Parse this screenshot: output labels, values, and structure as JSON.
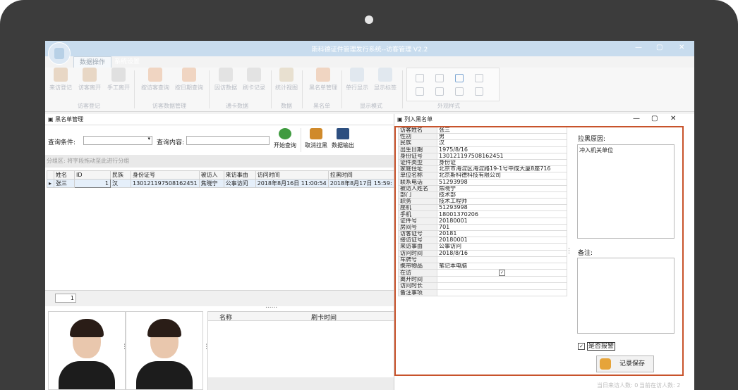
{
  "app": {
    "title": "斯科德证件管理发行系统--访客管理 V2.2",
    "tabs": [
      "数据操作",
      "系统设置"
    ]
  },
  "ribbon": {
    "buttons": [
      "来访登记",
      "访客离开",
      "手工离开",
      "按访客查询",
      "按日期查询",
      "因访数据",
      "刷卡记录",
      "统计视图",
      "黑名单管理",
      "单行显示",
      "显示标签"
    ],
    "groups": [
      "访客登记",
      "访客数据管理",
      "通卡数据",
      "数据",
      "黑名单",
      "显示模式",
      "外观样式"
    ]
  },
  "blacklist_window": {
    "title": "黑名单管理",
    "query_condition_label": "查询条件:",
    "query_content_label": "查询内容:",
    "query_condition_value": "",
    "query_content_value": "",
    "buttons": {
      "search": "开始查询",
      "remove": "取消拉黑",
      "export": "数据输出"
    },
    "group_hint": "分组区: 将字段拖动至此进行分组",
    "columns": [
      "姓名",
      "ID",
      "民族",
      "身份证号",
      "被访人",
      "来访事由",
      "访问时间",
      "拉黑时间"
    ],
    "rows": [
      {
        "name": "张三",
        "id": "1",
        "ethnicity": "汉",
        "id_card": "130121197508162451",
        "visited": "焦晓宁",
        "reason": "公事访问",
        "visit_time": "2018年8月16日 11:00:54",
        "black_time": "2018年8月17日 15:59:"
      }
    ],
    "page": "1",
    "splitter": "......",
    "record_columns": [
      "名称",
      "刷卡时间"
    ]
  },
  "add_blacklist_window": {
    "title": "列入黑名单",
    "fields": [
      {
        "k": "访客姓名",
        "v": "张三"
      },
      {
        "k": "性别",
        "v": "男"
      },
      {
        "k": "民族",
        "v": "汉"
      },
      {
        "k": "出生日期",
        "v": "1975/8/16"
      },
      {
        "k": "身份证号",
        "v": "130121197508162451"
      },
      {
        "k": "证件类型",
        "v": "身份证"
      },
      {
        "k": "家庭住址",
        "v": "北京市海淀区海淀路19-1号中成大厦8座716"
      },
      {
        "k": "单位名称",
        "v": "北京斯科德科技有限公司"
      },
      {
        "k": "联系电话",
        "v": "51293998"
      },
      {
        "k": "被访人姓名",
        "v": "焦晓宁"
      },
      {
        "k": "部门",
        "v": "技术部"
      },
      {
        "k": "职务",
        "v": "技术工程师"
      },
      {
        "k": "座机",
        "v": "51293998"
      },
      {
        "k": "手机",
        "v": "18001370206"
      },
      {
        "k": "证件号",
        "v": "20180001"
      },
      {
        "k": "房间号",
        "v": "701"
      },
      {
        "k": "访客证号",
        "v": "20181"
      },
      {
        "k": "接访证号",
        "v": "20180001"
      },
      {
        "k": "来访事由",
        "v": "公事访问"
      },
      {
        "k": "访问时间",
        "v": "2018/8/16"
      },
      {
        "k": "车牌号",
        "v": ""
      },
      {
        "k": "携带物品",
        "v": "笔记本电脑"
      },
      {
        "k": "在访",
        "v": ""
      },
      {
        "k": "离开时间",
        "v": ""
      },
      {
        "k": "访问时长",
        "v": ""
      },
      {
        "k": "备注事项",
        "v": ""
      }
    ],
    "in_visit_checked": true,
    "reason_label": "拉黑原因:",
    "reason_text": "冲入机关单位",
    "remark_label": "备注:",
    "remark_text": "",
    "alarm_label": "是否报警",
    "alarm_checked": true,
    "save_label": "记录保存"
  },
  "status": {
    "today_visits": "当日来访人数: 0",
    "current_visits": "当前在访人数: 2"
  }
}
